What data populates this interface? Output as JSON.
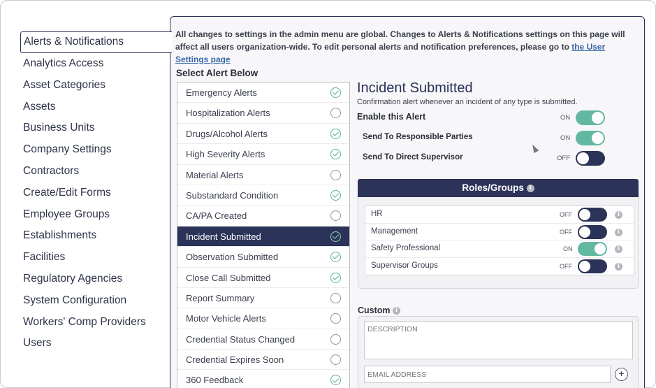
{
  "sidebar": {
    "items": [
      {
        "label": "Alerts & Notifications",
        "active": true
      },
      {
        "label": "Analytics Access"
      },
      {
        "label": "Asset Categories"
      },
      {
        "label": "Assets"
      },
      {
        "label": "Business Units"
      },
      {
        "label": "Company Settings"
      },
      {
        "label": "Contractors"
      },
      {
        "label": "Create/Edit Forms"
      },
      {
        "label": "Employee Groups"
      },
      {
        "label": "Establishments"
      },
      {
        "label": "Facilities"
      },
      {
        "label": "Regulatory Agencies"
      },
      {
        "label": "System Configuration"
      },
      {
        "label": "Workers' Comp Providers"
      },
      {
        "label": "Users"
      }
    ]
  },
  "notice": {
    "text": "All changes to settings in the admin menu are global. Changes to Alerts & Notifications settings on this page will affect all users organization-wide. To edit personal alerts and notification preferences, please go to ",
    "link": "the User Settings page"
  },
  "alert_list": {
    "title": "Select Alert Below",
    "items": [
      {
        "label": "Emergency Alerts",
        "enabled": true
      },
      {
        "label": "Hospitalization Alerts",
        "enabled": false
      },
      {
        "label": "Drugs/Alcohol Alerts",
        "enabled": true
      },
      {
        "label": "High Severity Alerts",
        "enabled": true
      },
      {
        "label": "Material Alerts",
        "enabled": false
      },
      {
        "label": "Substandard Condition",
        "enabled": true
      },
      {
        "label": "CA/PA Created",
        "enabled": false
      },
      {
        "label": "Incident Submitted",
        "enabled": true,
        "selected": true
      },
      {
        "label": "Observation Submitted",
        "enabled": true
      },
      {
        "label": "Close Call Submitted",
        "enabled": true
      },
      {
        "label": "Report Summary",
        "enabled": false
      },
      {
        "label": "Motor Vehicle Alerts",
        "enabled": false
      },
      {
        "label": "Credential Status Changed",
        "enabled": false
      },
      {
        "label": "Credential Expires Soon",
        "enabled": false
      },
      {
        "label": "360 Feedback",
        "enabled": true
      }
    ]
  },
  "detail": {
    "title": "Incident Submitted",
    "description": "Confirmation alert whenever an incident of any type is submitted.",
    "enable_label": "Enable this Alert",
    "enable_state": "ON",
    "responsible_label": "Send To Responsible Parties",
    "responsible_state": "ON",
    "supervisor_label": "Send To Direct Supervisor",
    "supervisor_state": "OFF"
  },
  "roles": {
    "header": "Roles/Groups",
    "rows": [
      {
        "name": "HR",
        "state": "OFF"
      },
      {
        "name": "Management",
        "state": "OFF"
      },
      {
        "name": "Safety Professional",
        "state": "ON"
      },
      {
        "name": "Supervisor Groups",
        "state": "OFF"
      }
    ]
  },
  "custom": {
    "label": "Custom",
    "description_placeholder": "DESCRIPTION",
    "email_placeholder": "EMAIL ADDRESS",
    "add_symbol": "+"
  },
  "colors": {
    "navy": "#2c3358",
    "toggle_on": "#62b8a0",
    "link": "#3a68a8"
  }
}
